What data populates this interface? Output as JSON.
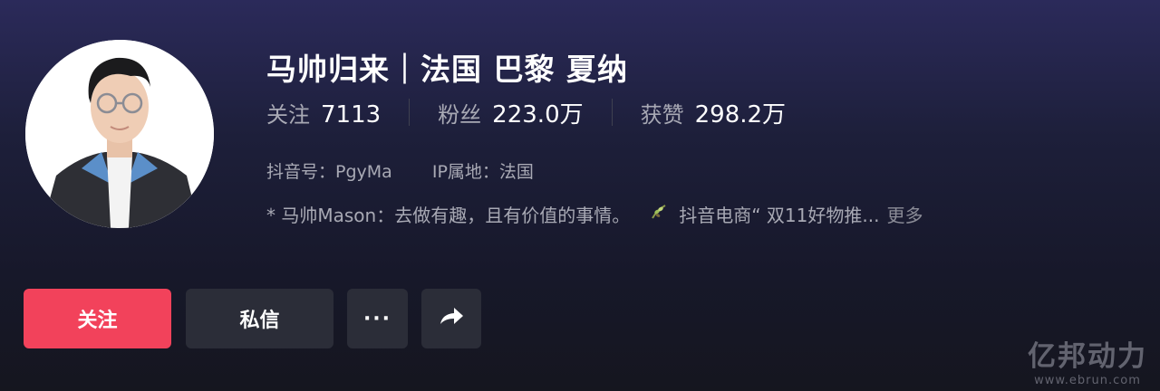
{
  "profile": {
    "name": "马帅归来｜法国 巴黎 夏纳",
    "stats": [
      {
        "label": "关注",
        "value": "7113"
      },
      {
        "label": "粉丝",
        "value": "223.0万"
      },
      {
        "label": "获赞",
        "value": "298.2万"
      }
    ],
    "douyin_id": "抖音号：PgyMa",
    "ip_location": "IP属地：法国",
    "bio_text": "* 马帅Mason：去做有趣，且有价值的事情。",
    "bio_extra": "抖音电商“ 双11好物推...",
    "bio_more": "更多"
  },
  "actions": {
    "follow_label": "关注",
    "message_label": "私信",
    "more_label": "···"
  },
  "watermark": {
    "brand": "亿邦动力",
    "url": "www.ebrun.com"
  },
  "colors": {
    "follow_button": "#f2425b",
    "secondary_button": "#2b2d38",
    "muted_text": "#a8a9b4"
  },
  "icons": {
    "share": "share-arrow-icon",
    "bio_leaf": "leaf-icon"
  }
}
